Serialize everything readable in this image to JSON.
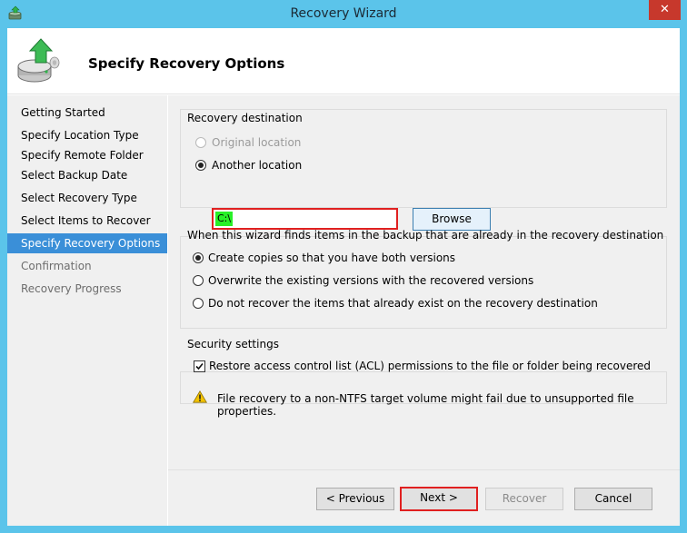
{
  "window": {
    "title": "Recovery Wizard",
    "close_glyph": "✕"
  },
  "header": {
    "title": "Specify Recovery Options",
    "icon": "backup-recovery-icon"
  },
  "nav": {
    "items": [
      {
        "label": "Getting Started",
        "state": "normal"
      },
      {
        "label": "Specify Location Type",
        "state": "normal"
      },
      {
        "label": "Specify Remote Folder",
        "state": "normal"
      },
      {
        "label": "Select Backup Date",
        "state": "normal"
      },
      {
        "label": "Select Recovery Type",
        "state": "normal"
      },
      {
        "label": "Select Items to Recover",
        "state": "normal"
      },
      {
        "label": "Specify Recovery Options",
        "state": "selected"
      },
      {
        "label": "Confirmation",
        "state": "disabled"
      },
      {
        "label": "Recovery Progress",
        "state": "disabled"
      }
    ]
  },
  "destination": {
    "group_label": "Recovery destination",
    "original_location": "Original location",
    "another_location": "Another location",
    "path_value": "C:\\",
    "browse_label": "Browse"
  },
  "conflict": {
    "group_label": "When this wizard finds items in the backup that are already in the recovery destination",
    "options": [
      "Create copies so that you have both versions",
      "Overwrite the existing versions with the recovered versions",
      "Do not recover the items that already exist on the recovery destination"
    ],
    "selected_index": 0
  },
  "security": {
    "group_label": "Security settings",
    "acl_label": "Restore access control list (ACL) permissions to the file or folder being recovered",
    "acl_checked": true,
    "warning_text": "File recovery to a non-NTFS target volume might fail due to unsupported file properties."
  },
  "footer": {
    "previous_label": "< Previous",
    "next_label": "Next >",
    "recover_label": "Recover",
    "cancel_label": "Cancel"
  },
  "colors": {
    "titlebar": "#5bc4ea",
    "nav_selected": "#3a8fd8",
    "highlight_frame": "#e02020",
    "path_highlight": "#28f028",
    "warning": "#f2c200"
  }
}
